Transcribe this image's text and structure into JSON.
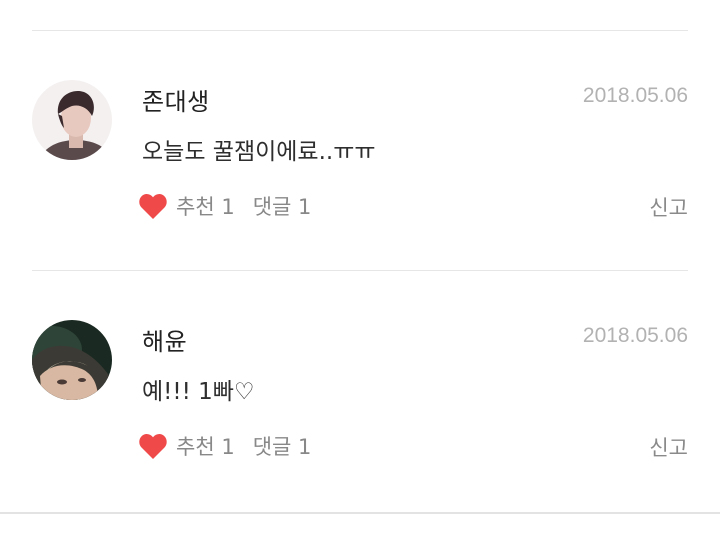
{
  "comments": [
    {
      "author": "존대생",
      "date": "2018.05.06",
      "text": "오늘도 꿀잼이에료..ㅠㅠ",
      "like_label": "추천 1",
      "reply_label": "댓글 1",
      "report_label": "신고",
      "avatar_icon": "user-avatar-photo"
    },
    {
      "author": "해윤",
      "date": "2018.05.06",
      "text": "예!!! 1빠♡",
      "like_label": "추천 1",
      "reply_label": "댓글 1",
      "report_label": "신고",
      "avatar_icon": "user-avatar-photo"
    }
  ],
  "colors": {
    "heart": "#f0494a",
    "date": "#b2b2b2",
    "meta": "#888888",
    "divider": "#e6e6e6"
  }
}
